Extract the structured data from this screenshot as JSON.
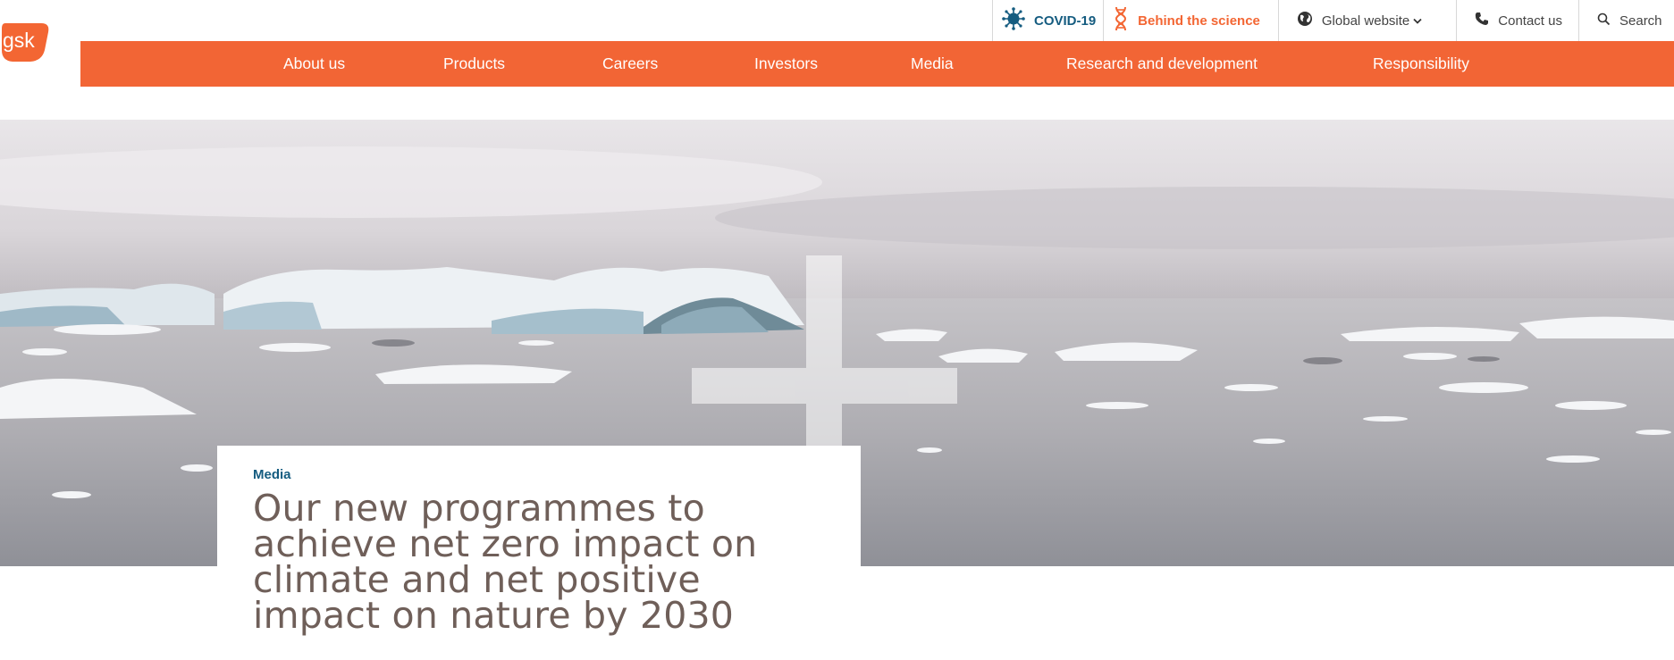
{
  "brand": {
    "logo_text": "gsk",
    "accent": "#f26535",
    "secondary": "#155c80",
    "title_color": "#6f5f59"
  },
  "utility_nav": {
    "covid": {
      "label": "COVID-19",
      "icon": "virus-icon"
    },
    "science": {
      "label": "Behind the science",
      "icon": "dna-icon"
    },
    "global": {
      "label": "Global website",
      "icon": "globe-icon",
      "chevron": "chevron-down-icon"
    },
    "contact": {
      "label": "Contact us",
      "icon": "phone-icon"
    },
    "search": {
      "label": "Search",
      "icon": "search-icon"
    }
  },
  "main_nav": {
    "items": [
      {
        "label": "About us"
      },
      {
        "label": "Products"
      },
      {
        "label": "Careers"
      },
      {
        "label": "Investors"
      },
      {
        "label": "Media"
      },
      {
        "label": "Research and development"
      },
      {
        "label": "Responsibility"
      }
    ]
  },
  "hero": {
    "image": "icebergs-seascape",
    "overlay": "plus-graphic"
  },
  "article": {
    "category": "Media",
    "title": "Our new programmes to achieve net zero impact on climate and net positive impact on nature by 2030"
  }
}
